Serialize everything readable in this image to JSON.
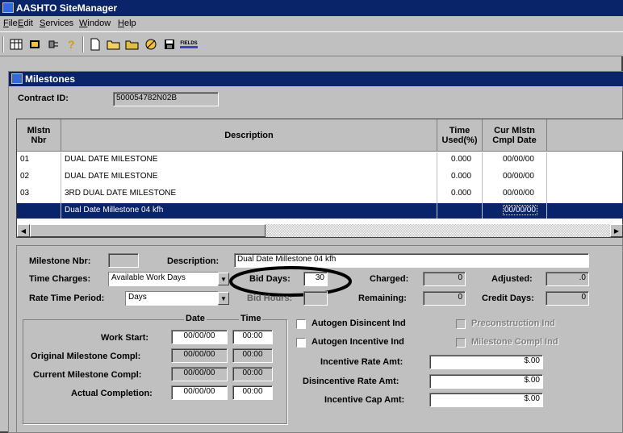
{
  "app": {
    "title": "AASHTO SiteManager"
  },
  "menu": [
    "File",
    "Edit",
    "Services",
    "Window",
    "Help"
  ],
  "menu_underline": [
    "F",
    "E",
    "S",
    "W",
    "H"
  ],
  "toolbar": {
    "icons": [
      "grid-icon",
      "open-folder-icon",
      "plug-icon",
      "help-icon",
      "new-document-icon",
      "open-icon",
      "folder-icon",
      "wizard-icon",
      "save-icon",
      "fields-icon"
    ],
    "fields_label": "FIELDS"
  },
  "window": {
    "title": "Milestones"
  },
  "contract": {
    "label": "Contract ID:",
    "value": "500054782N02B"
  },
  "grid": {
    "headers": {
      "nbr": "Mlstn\nNbr",
      "description": "Description",
      "time_used": "Time\nUsed(%)",
      "cur_cmpl": "Cur Mlstn\nCmpl Date"
    },
    "rows": [
      {
        "nbr": "01",
        "description": "DUAL DATE MILESTONE",
        "time_used": "0.000",
        "date": "00/00/00"
      },
      {
        "nbr": "02",
        "description": "DUAL DATE MILESTONE",
        "time_used": "0.000",
        "date": "00/00/00"
      },
      {
        "nbr": "03",
        "description": "3RD DUAL DATE MILESTONE",
        "time_used": "0.000",
        "date": "00/00/00"
      },
      {
        "nbr": "",
        "description": "Dual Date Millestone 04 kfh",
        "time_used": "",
        "date": "00/00/00"
      }
    ]
  },
  "detail": {
    "milestone_nbr_label": "Milestone Nbr:",
    "milestone_nbr_value": "",
    "description_label": "Description:",
    "description_value": "Dual Date Millestone 04 kfh",
    "time_charges_label": "Time Charges:",
    "time_charges_value": "Available Work Days",
    "bid_days_label": "Bid Days:",
    "bid_days_value": "30",
    "bid_hours_label": "Bid Hours:",
    "charged_label": "Charged:",
    "charged_value": "0",
    "adjusted_label": "Adjusted:",
    "adjusted_value": ".0",
    "rate_period_label": "Rate Time Period:",
    "rate_period_value": "Days",
    "remaining_label": "Remaining:",
    "remaining_value": "0",
    "credit_days_label": "Credit Days:",
    "credit_days_value": "0",
    "date_header": "Date",
    "time_header": "Time",
    "work_start_label": "Work Start:",
    "orig_compl_label": "Original Milestone Compl:",
    "cur_compl_label": "Current Milestone Compl:",
    "actual_compl_label": "Actual Completion:",
    "date_value": "00/00/00",
    "time_value": "00:00",
    "autogen_disincent_label": "Autogen Disincent Ind",
    "autogen_incentive_label": "Autogen Incentive Ind",
    "precon_label": "Preconstruction Ind",
    "milestone_compl_label": "Milestone Compl Ind",
    "incentive_rate_label": "Incentive Rate Amt:",
    "incentive_rate_value": "$.00",
    "disincentive_rate_label": "Disincentive Rate Amt:",
    "disincentive_rate_value": "$.00",
    "incentive_cap_label": "Incentive Cap Amt:",
    "incentive_cap_value": "$.00"
  }
}
